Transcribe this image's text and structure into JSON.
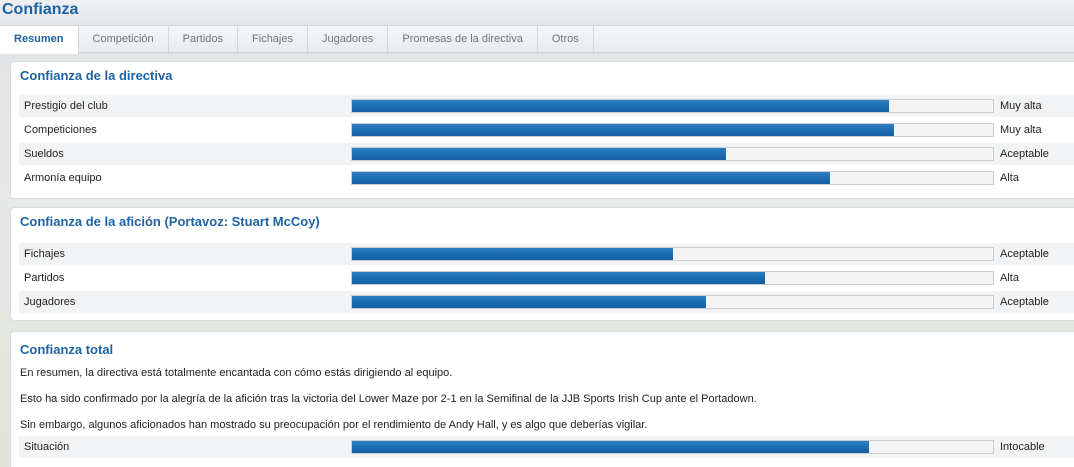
{
  "title": "Confianza",
  "tabs": [
    {
      "label": "Resumen",
      "active": true
    },
    {
      "label": "Competición",
      "active": false
    },
    {
      "label": "Partidos",
      "active": false
    },
    {
      "label": "Fichajes",
      "active": false
    },
    {
      "label": "Jugadores",
      "active": false
    },
    {
      "label": "Promesas de la directiva",
      "active": false
    },
    {
      "label": "Otros",
      "active": false
    }
  ],
  "colors": {
    "accent": "#1d63a6",
    "bar": "#1a6aae"
  },
  "board": {
    "title": "Confianza de la directiva",
    "rows": [
      {
        "label": "Prestigio del club",
        "value": "Muy alta",
        "level": 0.837
      },
      {
        "label": "Competiciones",
        "value": "Muy alta",
        "level": 0.845
      },
      {
        "label": "Sueldos",
        "value": "Aceptable",
        "level": 0.583
      },
      {
        "label": "Armonía equipo",
        "value": "Alta",
        "level": 0.745
      }
    ]
  },
  "fans": {
    "title": "Confianza de la afición (Portavoz: Stuart McCoy)",
    "rows": [
      {
        "label": "Fichajes",
        "value": "Aceptable",
        "level": 0.501
      },
      {
        "label": "Partidos",
        "value": "Alta",
        "level": 0.644
      },
      {
        "label": "Jugadores",
        "value": "Aceptable",
        "level": 0.552
      }
    ]
  },
  "total": {
    "title": "Confianza total",
    "paragraphs": [
      "En resumen, la directiva está totalmente encantada con cómo estás dirigiendo al equipo.",
      "Esto ha sido confirmado por la alegría de la afición tras la victoria del Lower Maze por 2-1 en la Semifinal de la JJB Sports Irish Cup ante el Portadown.",
      "Sin embargo, algunos aficionados han mostrado su preocupación por el rendimiento de Andy Hall, y es algo que deberías vigilar."
    ],
    "row": {
      "label": "Situación",
      "value": "Intocable",
      "level": 0.806
    }
  }
}
